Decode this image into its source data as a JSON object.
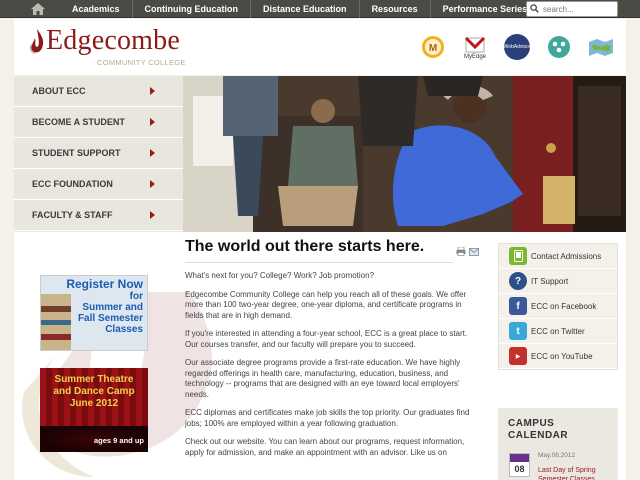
{
  "topbar": {
    "nav": [
      "Academics",
      "Continuing Education",
      "Distance Education",
      "Resources",
      "Performance Series"
    ],
    "search_placeholder": "search..."
  },
  "header": {
    "logo_name": "Edgecombe",
    "logo_sub": "COMMUNITY COLLEGE",
    "quick_links": [
      {
        "label": "M",
        "icon": "moodle-icon"
      },
      {
        "label": "MyEdge",
        "icon": "myedge-icon"
      },
      {
        "label": "WebAdvisor",
        "icon": "webadvisor-icon"
      },
      {
        "label": "",
        "icon": "people-icon"
      },
      {
        "label": "",
        "icon": "map-icon"
      }
    ]
  },
  "leftnav": {
    "items": [
      "ABOUT ECC",
      "BECOME A STUDENT",
      "STUDENT SUPPORT",
      "ECC FOUNDATION",
      "FACULTY & STAFF"
    ]
  },
  "promos": {
    "register": {
      "line1": "Register Now",
      "line2": "for",
      "line3": "Summer and",
      "line4": "Fall Semester",
      "line5": "Classes"
    },
    "theatre": {
      "line1": "Summer Theatre",
      "line2": "and Dance Camp",
      "line3": "June 2012",
      "line4": "ages 9 and up"
    }
  },
  "content": {
    "heading": "The world out there starts here.",
    "paragraphs": [
      "What's next for you? College? Work? Job promotion?",
      "Edgecombe Community College can help you reach all of these goals. We offer more than 100 two-year degree, one-year diploma, and certificate programs in fields that are in high demand.",
      "If you're interested in attending a four-year school, ECC is a great place to start. Our courses transfer, and our faculty will prepare you to succeed.",
      "Our associate degree programs provide a first-rate education. We have highly regarded offerings in health care, manufacturing, education, business, and technology -- programs that are designed with an eye toward local employers' needs.",
      "ECC diplomas and certificates make job skills the top priority. Our graduates find jobs; 100% are employed within a year following graduation.",
      "Check out our website. You can learn about our programs, request information, apply for admission, and make an appointment with an advisor. Like us on"
    ]
  },
  "sidebar": {
    "links": [
      {
        "label": "Contact Admissions",
        "icon": "phone-icon",
        "color": "#7ab82e"
      },
      {
        "label": "IT Support",
        "icon": "question-icon",
        "color": "#2d4f8a"
      },
      {
        "label": "ECC on Facebook",
        "icon": "facebook-icon",
        "color": "#3b5998"
      },
      {
        "label": "ECC on Twitter",
        "icon": "twitter-icon",
        "color": "#3aa7d9"
      },
      {
        "label": "ECC on YouTube",
        "icon": "youtube-icon",
        "color": "#c4302b"
      }
    ]
  },
  "calendar": {
    "title": "CAMPUS CALENDAR",
    "icon_day": "08",
    "date": "May.08.2012",
    "event": "Last Day of Spring Semester Classes"
  },
  "colors": {
    "brand": "#8b1a1a",
    "topbar": "#4b4b46",
    "nav_arrow": "#a01717"
  }
}
